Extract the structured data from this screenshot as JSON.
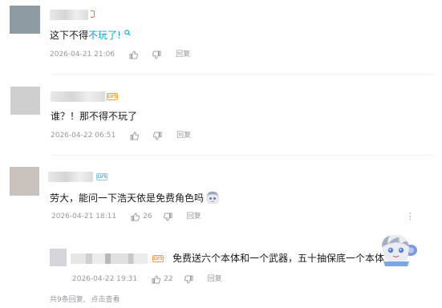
{
  "comments": [
    {
      "text_plain": "这下不得",
      "text_link": "不玩了!",
      "date": "2026-04-21 21:06",
      "like_count": "",
      "reply_label": "回复",
      "avatar_color": "#8e9ba3"
    },
    {
      "text_plain": "谁？！那不得不玩了",
      "date": "2026-04-22 06:51",
      "like_count": "",
      "reply_label": "回复",
      "avatar_color": "#cfcfcf",
      "level": "LV5"
    },
    {
      "text_plain": "劳大，能问一下浩天依是免费角色吗",
      "date": "2026-04-21 18:11",
      "like_count": "26",
      "reply_label": "回复",
      "avatar_color": "#c9c2bd",
      "level": "LV5"
    }
  ],
  "reply": {
    "text_plain": "免费送六个本体和一个武器，五十抽保底一个本体",
    "date": "2026-04-22 19:31",
    "like_count": "22",
    "reply_label": "回复",
    "avatar_color": "#d4d6dc",
    "level": "LV5"
  },
  "footer": {
    "reply_count": "共9条回复,",
    "view_more": "点击查看"
  },
  "colors": {
    "link": "#0f9fde",
    "meta": "#9499a0",
    "text": "#18191c"
  }
}
